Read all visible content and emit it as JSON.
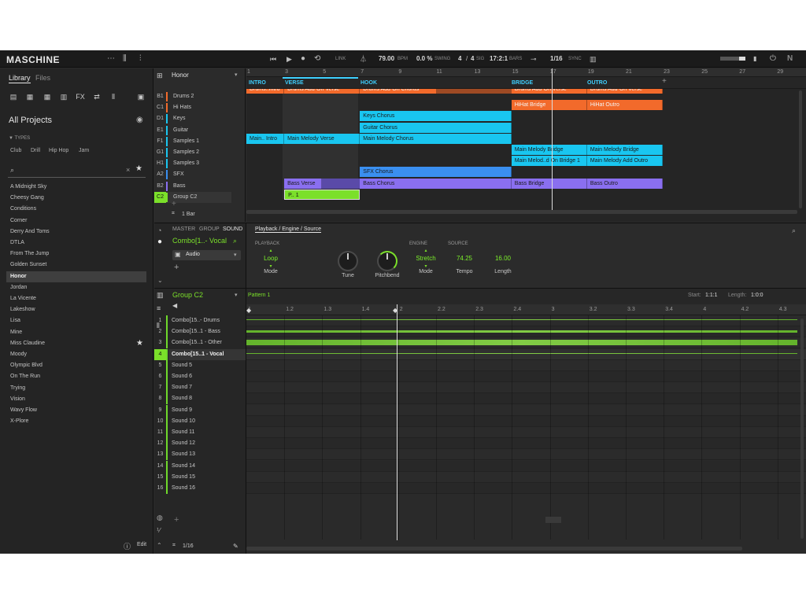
{
  "app": {
    "name": "MASCHINE"
  },
  "transport": {
    "link": "LINK",
    "bpm": "79.00",
    "bpm_label": "BPM",
    "swing": "0.0 %",
    "swing_label": "SWING",
    "sig_num": "4",
    "sig_slash": "/",
    "sig_den": "4",
    "sig_label": "SIG",
    "position": "17:2:1",
    "bars_label": "BARS",
    "grid": "1/16",
    "sync": "SYNC"
  },
  "sidebar": {
    "tabs": [
      "Library",
      "Files"
    ],
    "title": "All Projects",
    "types_label": "TYPES",
    "types": [
      "Club",
      "Drill",
      "Hip Hop",
      "Jam"
    ],
    "search_placeholder": "",
    "projects": [
      "A Midnight Sky",
      "Cheesy Gang",
      "Conditions",
      "Corner",
      "Derry And Toms",
      "DTLA",
      "From The Jump",
      "Golden Sunset",
      "Honor",
      "Jordan",
      "La Vicente",
      "Lakeshow",
      "Lisa",
      "Mine",
      "Miss Claudine",
      "Moody",
      "Olympic Blvd",
      "On The Run",
      "Trying",
      "Vision",
      "Wavy Flow",
      "X-Plore"
    ],
    "selected": "Honor",
    "edit_label": "Edit"
  },
  "arranger": {
    "project_name": "Honor",
    "sections": [
      "INTRO",
      "VERSE",
      "HOOK",
      "BRIDGE",
      "OUTRO"
    ],
    "ruler": [
      "1",
      "3",
      "5",
      "7",
      "9",
      "11",
      "13",
      "15",
      "17",
      "19",
      "21",
      "23",
      "25",
      "27",
      "29"
    ],
    "lanes": [
      {
        "id": "B1",
        "name": "Drums 2",
        "color": "#f26a2b"
      },
      {
        "id": "C1",
        "name": "Hi Hats",
        "color": "#f26a2b"
      },
      {
        "id": "D1",
        "name": "Keys",
        "color": "#19c6f0"
      },
      {
        "id": "E1",
        "name": "Guitar",
        "color": "#19c6f0"
      },
      {
        "id": "F1",
        "name": "Samples 1",
        "color": "#19c6f0"
      },
      {
        "id": "G1",
        "name": "Samples 2",
        "color": "#19c6f0"
      },
      {
        "id": "H1",
        "name": "Samples 3",
        "color": "#19c6f0"
      },
      {
        "id": "A2",
        "name": "SFX",
        "color": "#3a8ff0"
      },
      {
        "id": "B2",
        "name": "Bass",
        "color": "#8a6ff0"
      },
      {
        "id": "C2",
        "name": "Group C2",
        "color": "#7be02a"
      }
    ],
    "clips": {
      "drums_intro": "Drums..Intro",
      "drums_verse": "Drums Add-On Verse",
      "drums_chorus": "Drums Add-On Chorus",
      "drums_bridge": "Drums Add-On Verse",
      "drums_outro": "Drums Add-On Verse",
      "hihat_bridge": "HiHat Bridge",
      "hihat_outro": "HiHat Outro",
      "keys_chorus": "Keys Chorus",
      "guitar_chorus": "Guitar Chorus",
      "main_intro": "Main.. Intro",
      "main_verse": "Main Melody Verse",
      "main_chorus": "Main Melody Chorus",
      "main_bridge": "Main Melody Bridge",
      "main_bridge2": "Main Melody Bridge",
      "main_melod_bridge1": "Main Melod..d On Bridge 1",
      "main_add_outro": "Main Melody Add Outro",
      "sfx_chorus": "SFX Chorus",
      "bass_verse": "Bass Verse",
      "bass_chorus": "Bass Chorus",
      "bass_bridge": "Bass Bridge",
      "bass_outro": "Bass Outro",
      "group_p1": "P.. 1"
    },
    "bar_length": "1 Bar"
  },
  "device": {
    "tabs": [
      "MASTER",
      "GROUP",
      "SOUND"
    ],
    "sound_name": "Combo[1..- Vocal",
    "plugin": "Audio",
    "breadcrumb": "Playback / Engine / Source",
    "sec_playback": "PLAYBACK",
    "sec_engine": "ENGINE",
    "sec_source": "SOURCE",
    "params": [
      {
        "value": "Loop",
        "label": "Mode"
      },
      {
        "value": "",
        "label": "Tune"
      },
      {
        "value": "",
        "label": "Pitchbend"
      },
      {
        "value": "Stretch",
        "label": "Mode"
      },
      {
        "value": "74.25",
        "label": "Tempo"
      },
      {
        "value": "16.00",
        "label": "Length"
      }
    ]
  },
  "pattern_editor": {
    "group_name": "Group C2",
    "pattern_name": "Pattern 1",
    "start_label": "Start:",
    "start_value": "1:1:1",
    "length_label": "Length:",
    "length_value": "1:0:0",
    "ruler": [
      "1",
      "1.2",
      "1.3",
      "1.4",
      "2",
      "2.2",
      "2.3",
      "2.4",
      "3",
      "3.2",
      "3.3",
      "3.4",
      "4",
      "4.2",
      "4.3"
    ],
    "sounds": [
      "Combo[15..- Drums",
      "Combo[15..1 - Bass",
      "Combo[15..1 - Other",
      "Combo[15..1 - Vocal",
      "Sound 5",
      "Sound 6",
      "Sound 7",
      "Sound 8",
      "Sound 9",
      "Sound 10",
      "Sound 11",
      "Sound 12",
      "Sound 13",
      "Sound 14",
      "Sound 15",
      "Sound 16"
    ],
    "grid": "1/16"
  },
  "colors": {
    "accent_green": "#7be02a",
    "orange": "#f26a2b",
    "cyan": "#19c6f0",
    "blue": "#3a8ff0",
    "purple": "#8a6ff0"
  }
}
